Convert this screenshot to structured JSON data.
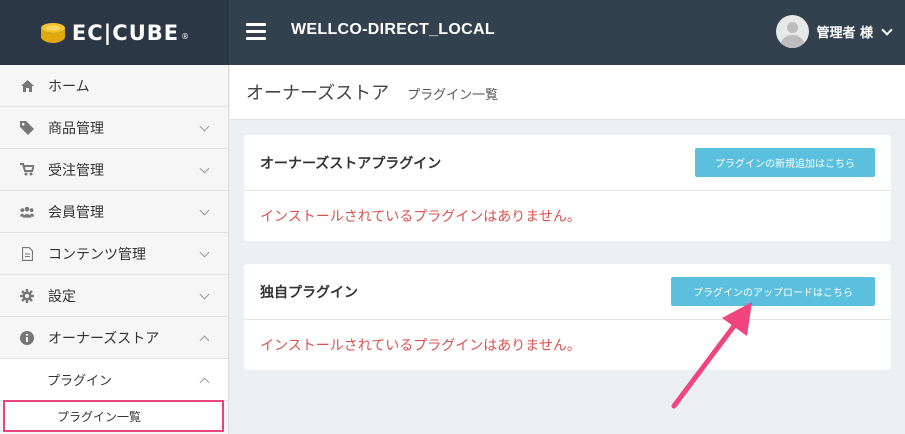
{
  "header": {
    "logo_text": "EC|CUBE",
    "logo_mark": "®",
    "shop_name": "WELLCO-DIRECT_LOCAL",
    "user_name": "管理者 様"
  },
  "sidebar": {
    "items": [
      {
        "label": "ホーム",
        "icon": "home-icon"
      },
      {
        "label": "商品管理",
        "icon": "tag-icon"
      },
      {
        "label": "受注管理",
        "icon": "cart-icon"
      },
      {
        "label": "会員管理",
        "icon": "users-icon"
      },
      {
        "label": "コンテンツ管理",
        "icon": "file-icon"
      },
      {
        "label": "設定",
        "icon": "gear-icon"
      },
      {
        "label": "オーナーズストア",
        "icon": "info-icon"
      }
    ],
    "sub_item": "プラグイン",
    "sub_sub_item": "プラグイン一覧"
  },
  "page": {
    "title": "オーナーズストア",
    "subtitle": "プラグイン一覧"
  },
  "cards": [
    {
      "title": "オーナーズストアプラグイン",
      "button": "プラグインの新規追加はこちら",
      "message": "インストールされているプラグインはありません。"
    },
    {
      "title": "独自プラグイン",
      "button": "プラグインのアップロードはこちら",
      "message": "インストールされているプラグインはありません。"
    }
  ],
  "colors": {
    "header_bg": "#33414e",
    "button_bg": "#5bc0de",
    "message": "#d9534f",
    "highlight": "#e8467c",
    "arrow": "#f0457e"
  }
}
